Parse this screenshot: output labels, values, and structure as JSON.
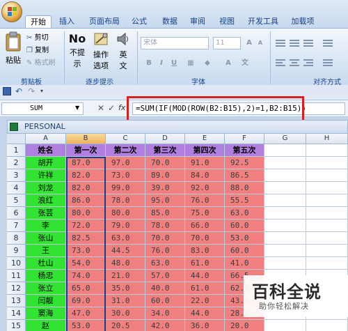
{
  "tabs": [
    "开始",
    "插入",
    "页面布局",
    "公式",
    "数据",
    "审阅",
    "视图",
    "开发工具",
    "加载项"
  ],
  "ribbon": {
    "clipboard": {
      "paste": "粘贴",
      "cut": "剪切",
      "copy": "复制",
      "format_painter": "格式刷",
      "label": "剪贴板"
    },
    "steps": {
      "no_prompt_line1": "不提",
      "no_prompt_line2": "示",
      "operate_line1": "操作",
      "operate_line2": "选项",
      "eng_line1": "英",
      "eng_line2": "文",
      "label": "逐步提示"
    },
    "font": {
      "name_placeholder": "宋体",
      "size_placeholder": "11",
      "label": "字体",
      "bold": "B",
      "italic": "I",
      "underline": "U"
    },
    "alignment": {
      "label": "对齐方式"
    }
  },
  "formula_bar": {
    "name_box": "SUM",
    "fx": "fx",
    "formula": "=SUM(IF(MOD(ROW(B2:B15),2)=1,B2:B15))"
  },
  "workbook": {
    "title": "PERSONAL"
  },
  "sheet": {
    "columns": [
      "A",
      "B",
      "C",
      "D",
      "E",
      "F",
      "G",
      "H"
    ],
    "headers": [
      "姓名",
      "第一次",
      "第二次",
      "第三次",
      "第四次",
      "第五次"
    ],
    "rows": [
      [
        "胡开",
        "87.0",
        "97.0",
        "70.0",
        "91.0",
        "92.5"
      ],
      [
        "许祥",
        "82.0",
        "73.0",
        "89.0",
        "84.0",
        "86.5"
      ],
      [
        "刘龙",
        "82.0",
        "99.0",
        "39.0",
        "92.0",
        "88.0"
      ],
      [
        "浪红",
        "86.0",
        "78.0",
        "95.0",
        "76.0",
        "55.5"
      ],
      [
        "张芸",
        "80.0",
        "80.0",
        "85.0",
        "75.0",
        "63.0"
      ],
      [
        "李",
        "72.0",
        "79.0",
        "78.0",
        "66.0",
        "60.0"
      ],
      [
        "张山",
        "82.5",
        "63.0",
        "70.0",
        "70.0",
        "53.0"
      ],
      [
        "王",
        "73.0",
        "44.5",
        "76.0",
        "83.0",
        "60.0"
      ],
      [
        "杜山",
        "54.0",
        "48.0",
        "63.0",
        "61.0",
        "41.0"
      ],
      [
        "杨忠",
        "74.0",
        "21.0",
        "57.0",
        "44.0",
        "66.5"
      ],
      [
        "张立",
        "65.0",
        "35.0",
        "40.0",
        "61.0",
        "62.0"
      ],
      [
        "闫靓",
        "69.0",
        "31.0",
        "60.0",
        "22.0",
        "43.0"
      ],
      [
        "窦海",
        "47.0",
        "30.0",
        "34.0",
        "44.0",
        "28.0"
      ],
      [
        "赵",
        "53.0",
        "20.5",
        "42.0",
        "36.0",
        "20.0"
      ]
    ]
  },
  "watermark": {
    "main": "百科全说",
    "sub": "助你轻松解决"
  },
  "colors": {
    "name_fill": "#33e233",
    "header_fill": "#b07fe0",
    "data_fill": "#f08080",
    "highlight_box": "#d72020"
  }
}
